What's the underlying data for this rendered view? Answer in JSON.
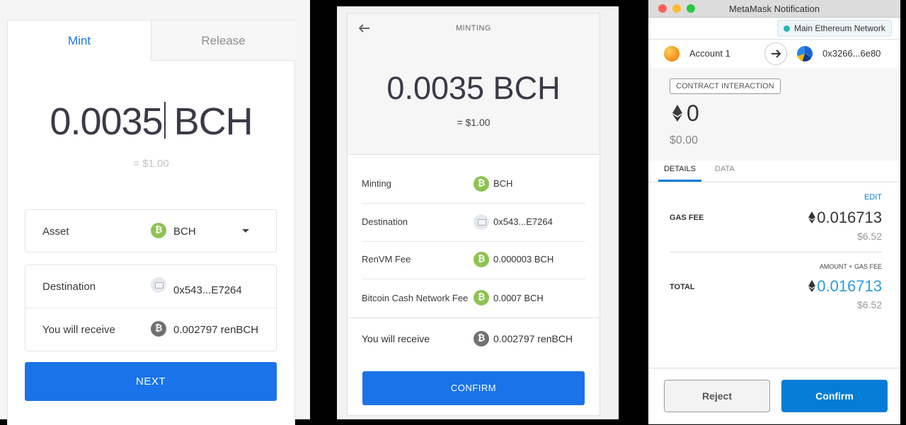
{
  "mint_form": {
    "tab_mint": "Mint",
    "tab_release": "Release",
    "amount": "0.0035",
    "currency": "BCH",
    "usd_value": "= $1.00",
    "asset_label": "Asset",
    "asset_value": "BCH",
    "destination_label": "Destination",
    "destination_value": "0x543...E7264",
    "receive_label": "You will receive",
    "receive_value": "0.002797 renBCH",
    "next_button": "NEXT"
  },
  "minting": {
    "title": "MINTING",
    "amount": "0.0035 BCH",
    "usd_value": "= $1.00",
    "rows": [
      {
        "label": "Minting",
        "value": "BCH",
        "icon": "bch-coin-icon"
      },
      {
        "label": "Destination",
        "value": "0x543...E7264",
        "icon": "wallet-icon"
      },
      {
        "label": "RenVM Fee",
        "value": "0.000003 BCH",
        "icon": "bch-coin-icon"
      },
      {
        "label": "Bitcoin Cash Network Fee",
        "value": "0.0007 BCH",
        "icon": "bch-coin-icon"
      }
    ],
    "receive_label": "You will receive",
    "receive_value": "0.002797 renBCH",
    "confirm_button": "CONFIRM"
  },
  "metamask": {
    "window_title": "MetaMask Notification",
    "network": "Main Ethereum Network",
    "account_name": "Account 1",
    "recipient": "0x3266...6e80",
    "badge": "CONTRACT INTERACTION",
    "eth_amount": "0",
    "usd_amount": "$0.00",
    "tab_details": "DETAILS",
    "tab_data": "DATA",
    "edit": "EDIT",
    "gas_fee_label": "GAS FEE",
    "gas_fee_eth": "0.016713",
    "gas_fee_usd": "$6.52",
    "amount_gas_label": "AMOUNT + GAS FEE",
    "total_label": "TOTAL",
    "total_eth": "0.016713",
    "total_usd": "$6.52",
    "reject_button": "Reject",
    "confirm_button": "Confirm"
  },
  "colors": {
    "accent_blue": "#1a73e8",
    "bch_green": "#8dc351",
    "metamask_blue": "#037dd6",
    "total_blue": "#2f9ae0"
  }
}
